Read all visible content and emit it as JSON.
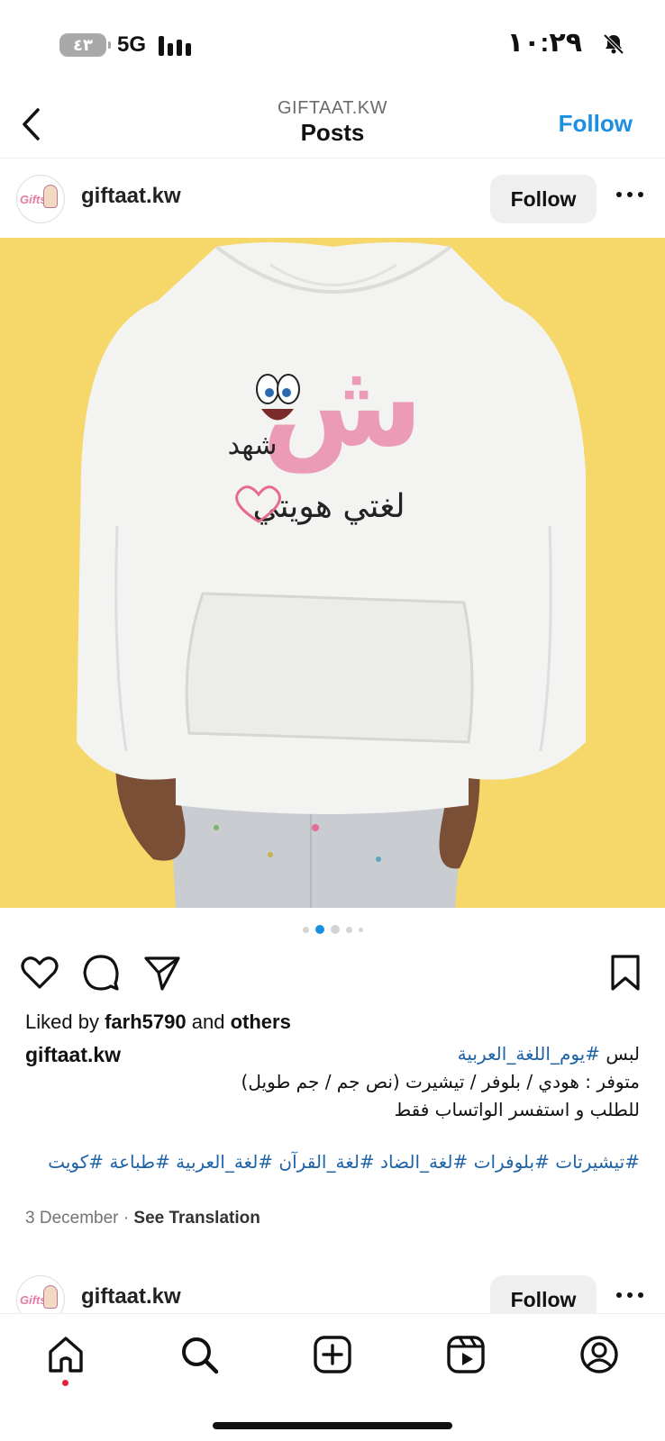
{
  "status_bar": {
    "battery": "٤٣",
    "network": "5G",
    "time": "١٠:٢٩",
    "icons": [
      "battery-icon",
      "signal-bars-icon",
      "bell-muted-icon"
    ]
  },
  "header": {
    "account": "GIFTAAT.KW",
    "title": "Posts",
    "follow_label": "Follow"
  },
  "post": {
    "username": "giftaat.kw",
    "avatar_text": "Gifts",
    "follow_label": "Follow",
    "image": {
      "background": "#f5d76a",
      "hoodie_text_big": "ش",
      "hoodie_name": "شهد",
      "hoodie_slogan": "لغتي هويتي"
    },
    "carousel": {
      "count": 5,
      "active_index": 1
    },
    "liked_prefix": "Liked by",
    "liked_user": "farh5790",
    "liked_and": "and",
    "liked_others": "others",
    "caption_user": "giftaat.kw",
    "caption_line1_text": "لبس",
    "caption_line1_tag": "#يوم_اللغة_العربية",
    "caption_line2": "متوفر : هودي / بلوفر / تيشيرت (نص جم / جم طويل)",
    "caption_line3": "للطلب و استفسر الواتساب فقط",
    "hashtags": "#تيشيرتات #بلوفرات #لغة_الضاد #لغة_القرآن #لغة_العربية #طباعة #كويت",
    "date": "3 December",
    "see_translation": "See Translation"
  },
  "next_post": {
    "username": "giftaat.kw",
    "avatar_text": "Gifts",
    "follow_label": "Follow"
  },
  "bottom_nav": [
    "home-icon",
    "search-icon",
    "create-post-icon",
    "reels-icon",
    "profile-icon"
  ],
  "colors": {
    "accent": "#1a8fe3",
    "hashtag": "#1e63a8",
    "notification": "#e61f3a"
  }
}
